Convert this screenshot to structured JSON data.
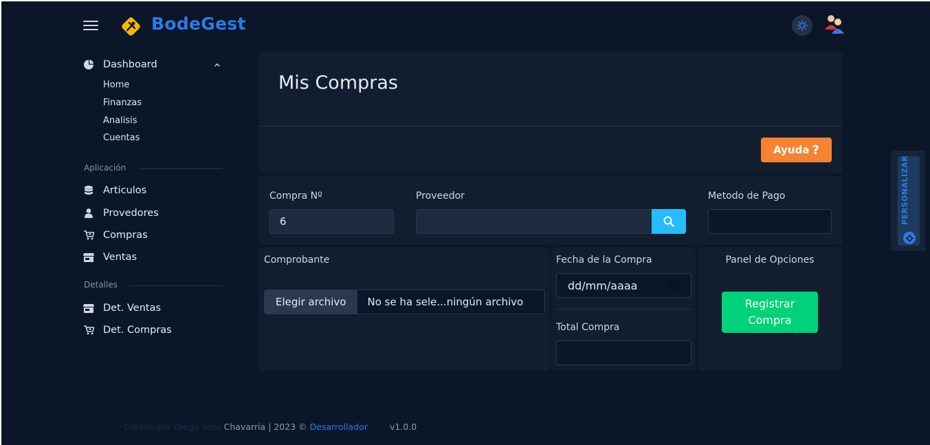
{
  "app": {
    "name": "BodeGest"
  },
  "sidebar": {
    "dashboard": {
      "label": "Dashboard",
      "items": [
        "Home",
        "Finanzas",
        "Analisis",
        "Cuentas"
      ]
    },
    "section_app": {
      "label": "Aplicación",
      "items": [
        "Articulos",
        "Provedores",
        "Compras",
        "Ventas"
      ]
    },
    "section_details": {
      "label": "Detalles",
      "items": [
        "Det. Ventas",
        "Det. Compras"
      ]
    }
  },
  "page": {
    "title": "Mis Compras",
    "help_label": "Ayuda",
    "help_icon": "?"
  },
  "form": {
    "compra_no": {
      "label": "Compra Nº",
      "value": "6"
    },
    "proveedor": {
      "label": "Proveedor",
      "value": ""
    },
    "metodo_pago": {
      "label": "Metodo de Pago",
      "value": ""
    },
    "comprobante": {
      "label": "Comprobante",
      "button": "Elegir archivo",
      "file_name": "No se ha sele...ningún archivo"
    },
    "fecha": {
      "label": "Fecha de la Compra",
      "placeholder": "dd/mm/aaaa"
    },
    "total": {
      "label": "Total Compra",
      "value": ""
    },
    "options": {
      "title": "Panel de Opciones",
      "register_line1": "Registrar",
      "register_line2": "Compra"
    }
  },
  "personalize": {
    "label": "PERSONALIZAR"
  },
  "footer": {
    "faded_text": "Creado por Diego Soto ",
    "text": "Chavarria | 2023 © ",
    "link": "Desarrollador",
    "version": "v1.0.0"
  },
  "colors": {
    "accent": "#2c7be5",
    "help": "#f68332",
    "success": "#00d27a",
    "search": "#27bcfd",
    "background": "#0b1629",
    "card": "#121e2f"
  }
}
